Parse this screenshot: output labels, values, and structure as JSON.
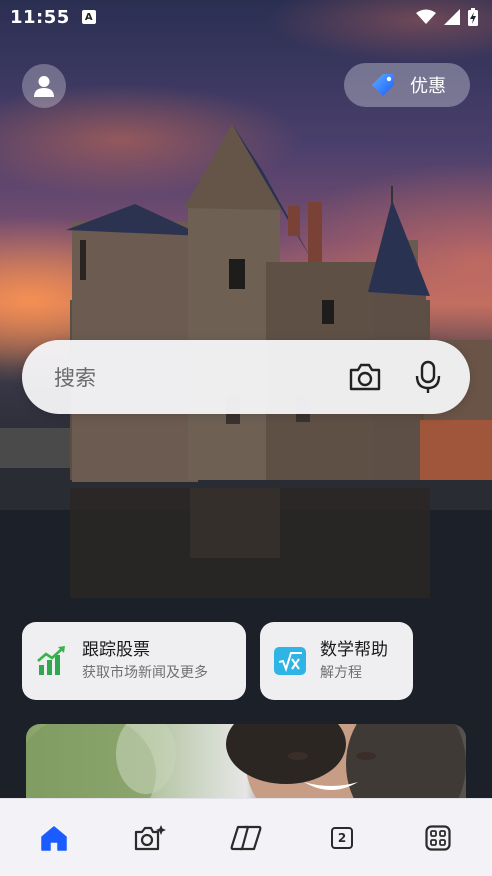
{
  "status_bar": {
    "time": "11:55",
    "notification_badge": "A"
  },
  "header": {
    "offers_label": "优惠"
  },
  "search": {
    "placeholder": "搜索"
  },
  "quick_cards": [
    {
      "title": "跟踪股票",
      "subtitle": "获取市场新闻及更多"
    },
    {
      "title": "数学帮助",
      "subtitle": "解方程"
    }
  ],
  "bottom_nav": {
    "tab_count": "2",
    "items": [
      "home-icon",
      "camera-sparkle-icon",
      "copilot-icon",
      "tabs-icon",
      "apps-grid-icon"
    ]
  },
  "colors": {
    "accent": "#1a5cff",
    "stocks_green": "#2fa84f",
    "math_teal": "#2fb4e6"
  }
}
